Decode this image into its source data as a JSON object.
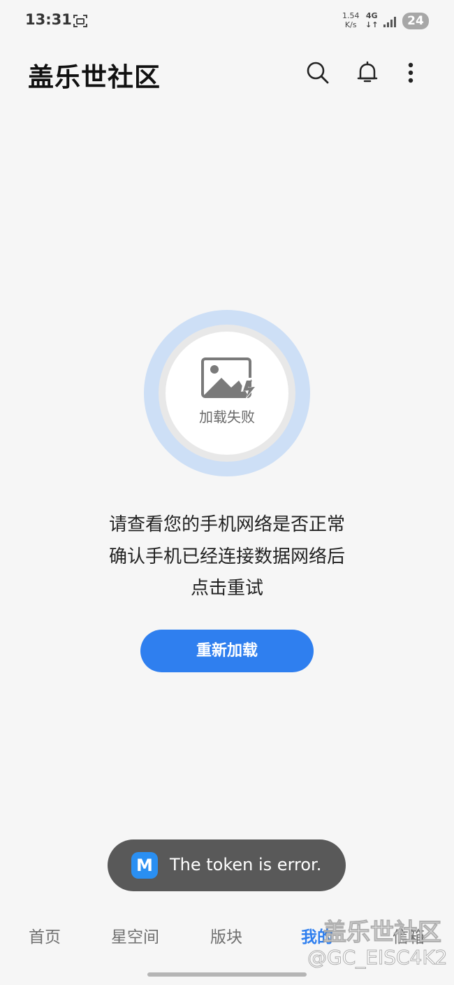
{
  "status_bar": {
    "time": "13:31",
    "speed_value": "1.54",
    "speed_unit": "K/s",
    "network_type": "4G",
    "network_arrows": "↓↑",
    "battery": "24"
  },
  "app_bar": {
    "title": "盖乐世社区",
    "icons": [
      "search-icon",
      "bell-icon",
      "more-vertical-icon"
    ]
  },
  "error": {
    "image_caption": "加载失败",
    "message_lines": [
      "请查看您的手机网络是否正常",
      "确认手机已经连接数据网络后",
      "点击重试"
    ],
    "reload_label": "重新加载"
  },
  "toast": {
    "icon_letter": "M",
    "text": "The token is error."
  },
  "bottom_nav": {
    "items": [
      {
        "label": "首页",
        "active": false
      },
      {
        "label": "星空间",
        "active": false
      },
      {
        "label": "版块",
        "active": false
      },
      {
        "label": "我的",
        "active": true
      },
      {
        "label": "信箱",
        "active": false
      }
    ]
  },
  "watermark": {
    "line1": "盖乐世社区",
    "line2": "@GC_EISC4K2"
  },
  "colors": {
    "accent": "#2f7fef",
    "ring": "#cddff6",
    "toast_bg": "#595959"
  }
}
